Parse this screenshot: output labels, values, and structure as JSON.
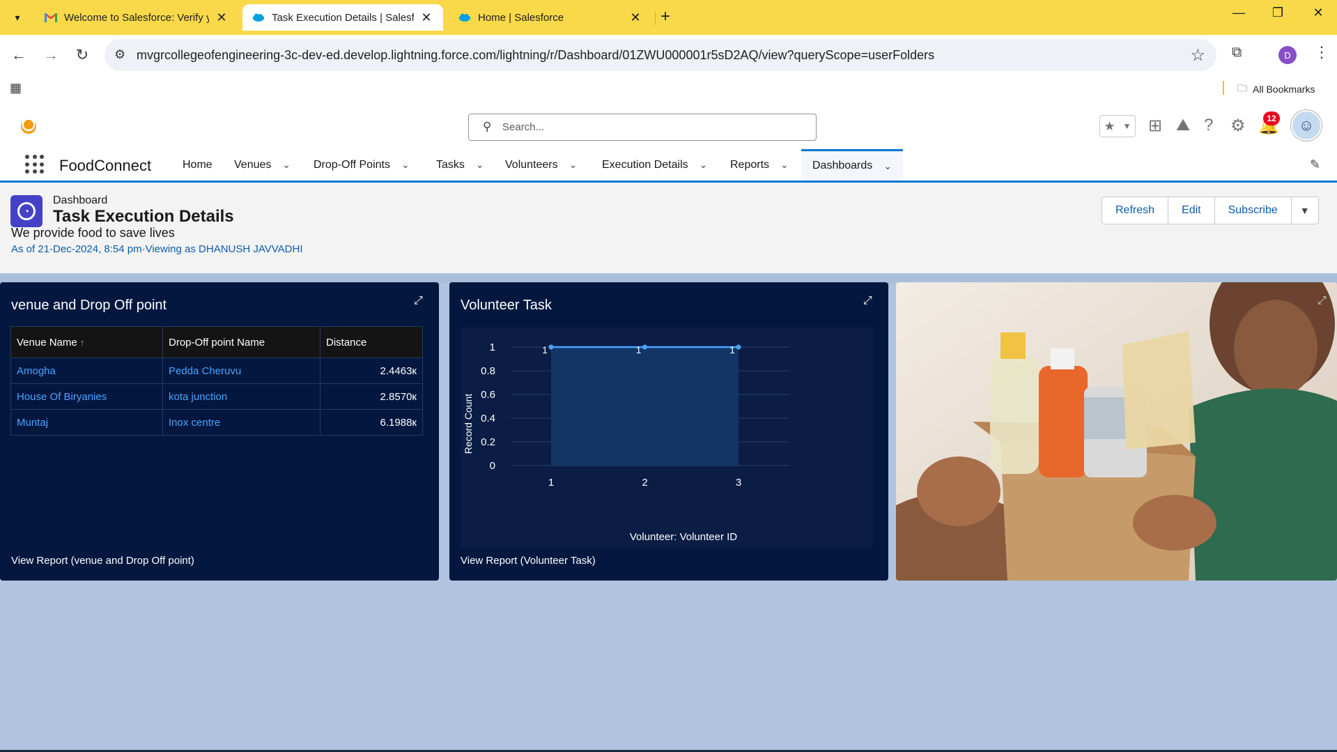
{
  "browser": {
    "tabs": [
      {
        "title": "Welcome to Salesforce: Verify y",
        "icon": "gmail-icon"
      },
      {
        "title": "Task Execution Details | Salesfor",
        "icon": "salesforce-cloud-icon"
      },
      {
        "title": "Home | Salesforce",
        "icon": "salesforce-cloud-icon"
      }
    ],
    "url": "mvgrcollegeofengineering-3c-dev-ed.develop.lightning.force.com/lightning/r/Dashboard/01ZWU000001r5sD2AQ/view?queryScope=userFolders",
    "profile_initial": "D",
    "all_bookmarks": "All Bookmarks"
  },
  "sf": {
    "search_placeholder": "Search...",
    "notification_count": "12",
    "app_name": "FoodConnect",
    "nav": [
      "Home",
      "Venues",
      "Drop-Off Points",
      "Tasks",
      "Volunteers",
      "Execution Details",
      "Reports",
      "Dashboards"
    ]
  },
  "dashboard": {
    "type_label": "Dashboard",
    "title": "Task Execution Details",
    "description": "We provide food to save lives",
    "meta": "As of 21-Dec-2024, 8:54 pm·Viewing as DHANUSH JAVVADHI",
    "buttons": {
      "refresh": "Refresh",
      "edit": "Edit",
      "subscribe": "Subscribe"
    }
  },
  "widgets": {
    "table_widget": {
      "title": "venue and Drop Off point",
      "columns": [
        "Venue Name",
        "Drop-Off point Name",
        "Distance"
      ],
      "sort_indicator": "↑",
      "rows": [
        [
          "Amogha",
          "Pedda Cheruvu",
          "2.4463к"
        ],
        [
          "House Of Biryanies",
          "kota junction",
          "2.8570к"
        ],
        [
          "Muntaj",
          "Inox centre",
          "6.1988к"
        ]
      ],
      "footer": "View Report (venue and Drop Off point)"
    },
    "chart_widget": {
      "title": "Volunteer Task",
      "footer": "View Report (Volunteer Task)"
    }
  },
  "chart_data": {
    "type": "area",
    "title": "Volunteer Task",
    "xlabel": "Volunteer: Volunteer ID",
    "ylabel": "Record Count",
    "categories": [
      "1",
      "2",
      "3"
    ],
    "values": [
      1,
      1,
      1
    ],
    "data_labels": [
      "1",
      "1",
      "1"
    ],
    "yticks": [
      "0",
      "0.2",
      "0.4",
      "0.6",
      "0.8",
      "1"
    ],
    "ylim": [
      0,
      1
    ],
    "grid": true,
    "color": "#4aa3ff"
  },
  "colors": {
    "accent": "#0176d3",
    "widget_bg": "#03173f",
    "canvas_bg": "#b0c4df",
    "tabbar": "#f9d94a"
  }
}
